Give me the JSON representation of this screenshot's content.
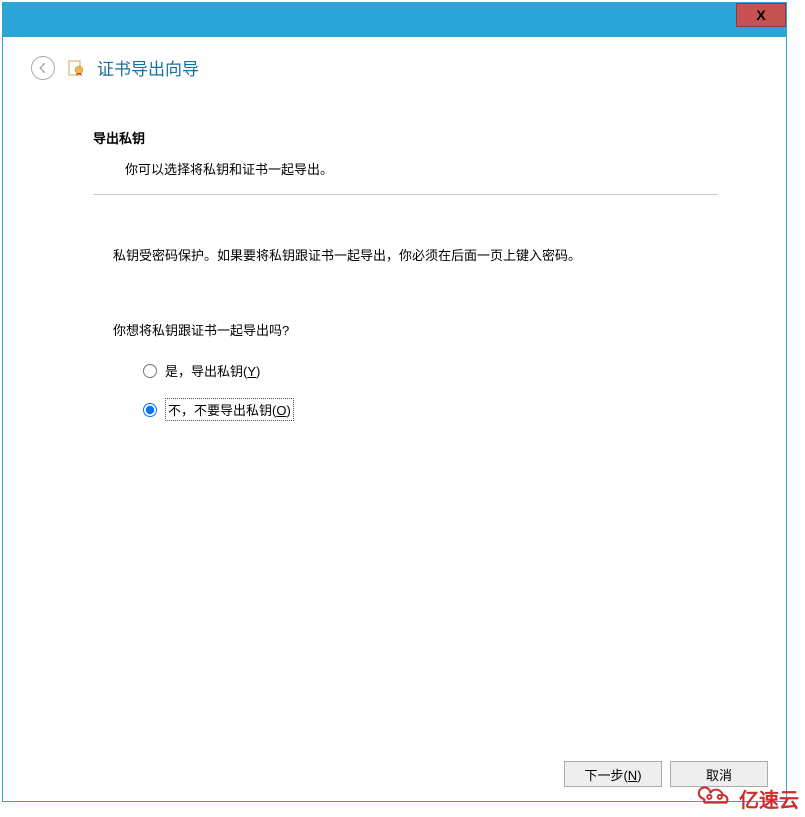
{
  "titlebar": {
    "close_label": "X"
  },
  "header": {
    "wizard_title": "证书导出向导"
  },
  "content": {
    "section_title": "导出私钥",
    "section_desc": "你可以选择将私钥和证书一起导出。",
    "info_text": "私钥受密码保护。如果要将私钥跟证书一起导出，你必须在后面一页上键入密码。",
    "question": "你想将私钥跟证书一起导出吗?",
    "option_yes_prefix": "是，导出私钥(",
    "option_yes_key": "Y",
    "option_yes_suffix": ")",
    "option_no_prefix": "不，不要导出私钥(",
    "option_no_key": "O",
    "option_no_suffix": ")"
  },
  "footer": {
    "next_prefix": "下一步(",
    "next_key": "N",
    "next_suffix": ")",
    "cancel": "取消"
  },
  "watermark": {
    "text": "亿速云"
  }
}
